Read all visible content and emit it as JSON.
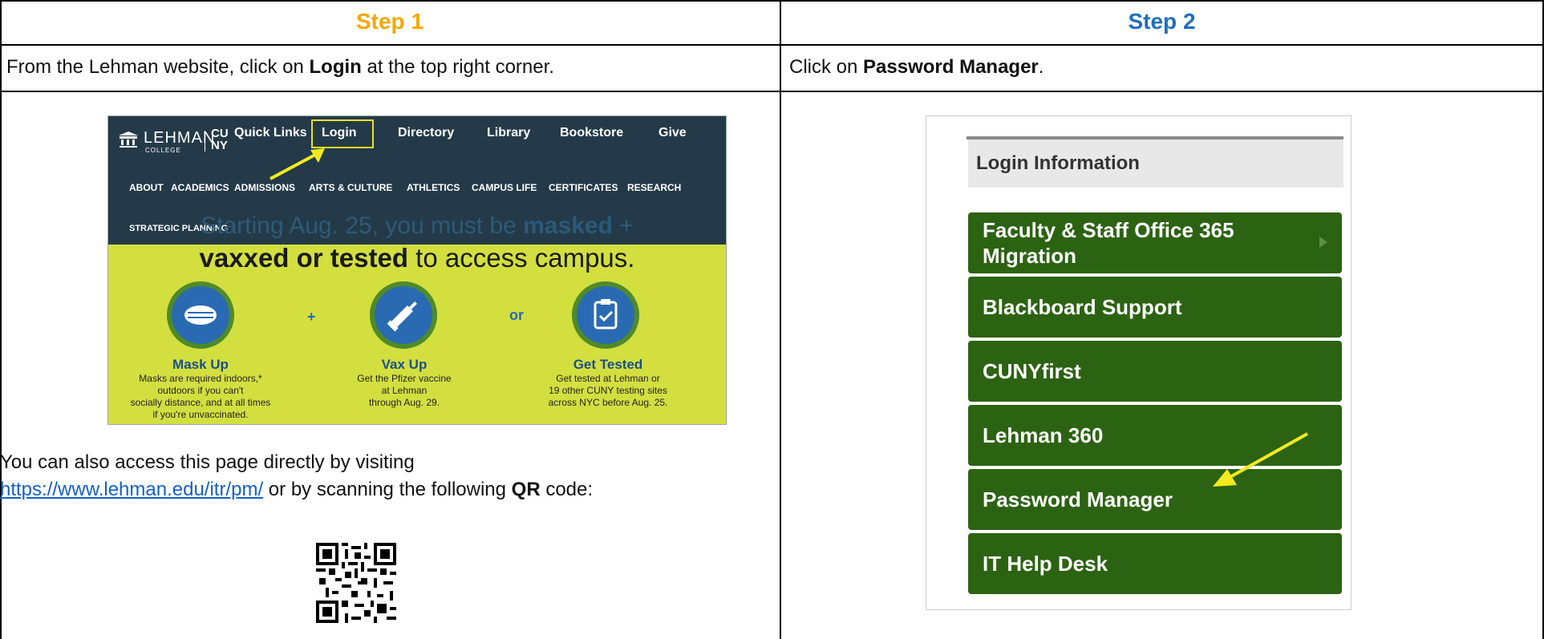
{
  "step1": {
    "title": "Step 1",
    "title_color": "#f5a800",
    "instruction_prefix": "From the Lehman website, click on ",
    "instruction_bold": "Login",
    "instruction_suffix": " at the top right corner.",
    "screenshot": {
      "logo_text": "LEHMAN",
      "logo_sub": "COLLEGE",
      "logo_cuny": "CU NY",
      "top_links": [
        "Quick Links",
        "Login",
        "Directory",
        "Library",
        "Bookstore",
        "Give"
      ],
      "nav_links": [
        "ABOUT",
        "ACADEMICS",
        "ADMISSIONS",
        "ARTS & CULTURE",
        "ATHLETICS",
        "CAMPUS LIFE",
        "CERTIFICATES",
        "RESEARCH"
      ],
      "nav_link_2": "STRATEGIC PLANNING",
      "banner_line1_pre": "Starting Aug. 25, you must be ",
      "banner_line1_bold": "masked",
      "banner_line1_post": " +",
      "banner_line2_bold": "vaxxed or tested",
      "banner_line2_post": " to access campus.",
      "connector_plus": "+",
      "connector_or": "or",
      "columns": [
        {
          "title": "Mask Up",
          "text": "Masks are required indoors,*\noutdoors if you can't\nsocially distance, and at all times\nif you're unvaccinated."
        },
        {
          "title": "Vax Up",
          "text": "Get the Pfizer vaccine\nat Lehman\nthrough Aug. 29."
        },
        {
          "title": "Get Tested",
          "text": "Get tested at Lehman or\n19 other CUNY testing sites\nacross NYC before Aug. 25."
        }
      ]
    },
    "para_line1": "You can also access this page directly by visiting",
    "para_link": "https://www.lehman.edu/itr/pm/",
    "para_mid": " or by scanning the following ",
    "para_bold": "QR",
    "para_end": " code:"
  },
  "step2": {
    "title": "Step 2",
    "title_color": "#1f6fbf",
    "instruction_prefix": "Click on ",
    "instruction_bold": "Password Manager",
    "instruction_suffix": ".",
    "screenshot": {
      "header": "Login Information",
      "menu": [
        "Faculty & Staff Office 365 Migration",
        "Blackboard Support",
        "CUNYfirst",
        "Lehman 360",
        "Password Manager",
        "IT Help Desk"
      ]
    }
  },
  "colors": {
    "arrow": "#f2ea1f",
    "nav_bg": "#243a48",
    "banner_bg": "#d3df3f",
    "menu_green": "#2c6312"
  }
}
